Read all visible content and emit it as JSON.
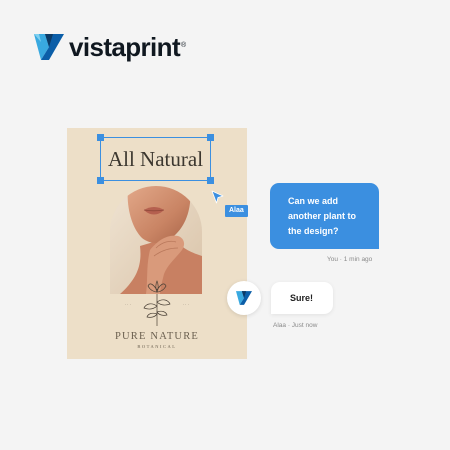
{
  "brand": {
    "name": "vistaprint",
    "registered_mark": "®",
    "logo_icon": "vistaprint-triangle-logo-icon"
  },
  "design": {
    "headline": "All Natural",
    "brand_title": "PURE NATURE",
    "brand_subtitle": "BOTANICAL",
    "side_text_left": "· · ·",
    "side_text_right": "· · ·",
    "background_color": "#eddfc8",
    "photo_subject": "arched-portrait-photo",
    "illustration": "botanical-flower-illustration"
  },
  "collaborator_cursor": {
    "label": "Alaa",
    "icon": "pointer-cursor-icon",
    "color": "#3b8fe0"
  },
  "chat": {
    "outgoing": {
      "text": "Can we add another plant to the design?",
      "meta": "You · 1 min ago",
      "color": "#3b8fe0"
    },
    "incoming": {
      "text": "Sure!",
      "meta": "Alaa · Just now",
      "avatar_icon": "vistaprint-logo-avatar-icon"
    }
  },
  "colors": {
    "accent_blue": "#3b8fe0",
    "logo_dark": "#0b3a66",
    "logo_light": "#39a9e0",
    "page_background": "#f4f4f4"
  }
}
